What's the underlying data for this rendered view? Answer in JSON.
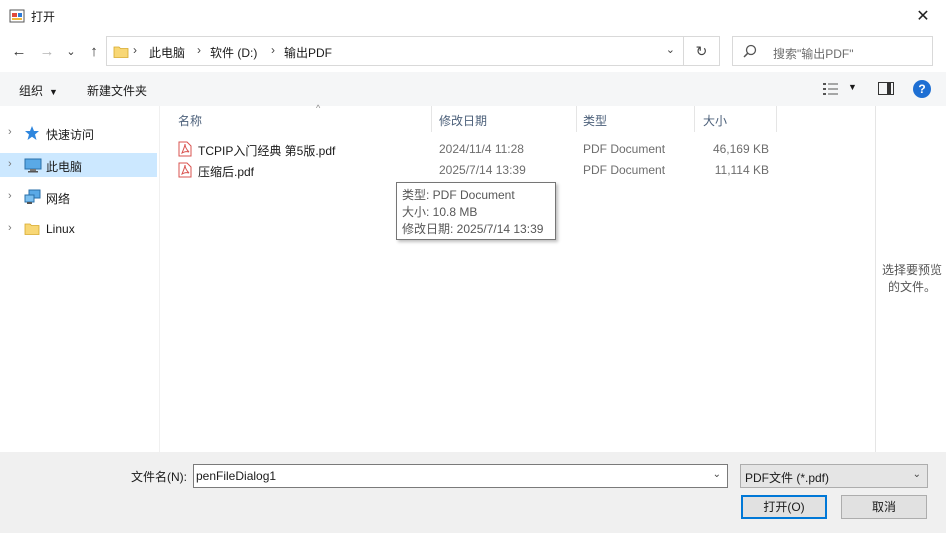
{
  "window": {
    "title": "打开",
    "close_glyph": "✕"
  },
  "nav": {
    "back_glyph": "←",
    "forward_glyph": "→",
    "recent_glyph": "⌄",
    "up_glyph": "↑",
    "refresh_glyph": "↻"
  },
  "address": {
    "crumbs": [
      "此电脑",
      "软件 (D:)",
      "输出PDF"
    ],
    "separator": "›",
    "dropdown_glyph": "⌄"
  },
  "search": {
    "placeholder": "搜索\"输出PDF\""
  },
  "toolbar": {
    "organize_label": "组织",
    "new_folder_label": "新建文件夹",
    "caret_glyph": "▼",
    "help_glyph": "?"
  },
  "sidebar": {
    "items": [
      {
        "label": "快速访问",
        "icon": "star-icon"
      },
      {
        "label": "此电脑",
        "icon": "computer-icon",
        "selected": true
      },
      {
        "label": "网络",
        "icon": "network-icon"
      },
      {
        "label": "Linux",
        "icon": "folder-icon"
      }
    ],
    "chevron_glyph": "›"
  },
  "columns": [
    "名称",
    "修改日期",
    "类型",
    "大小"
  ],
  "sort_glyph": "^",
  "files": [
    {
      "name": "TCPIP入门经典  第5版.pdf",
      "modified": "2024/11/4 11:28",
      "type": "PDF Document",
      "size": "46,169 KB"
    },
    {
      "name": "压缩后.pdf",
      "modified": "2025/7/14 13:39",
      "type": "PDF Document",
      "size": "11,114 KB"
    }
  ],
  "tooltip": {
    "type_line": "类型: PDF Document",
    "size_line": "大小: 10.8 MB",
    "date_line": "修改日期: 2025/7/14 13:39"
  },
  "preview": {
    "text": "选择要预览的文件。"
  },
  "footer": {
    "filename_label": "文件名(N):",
    "filename_value": "penFileDialog1",
    "filter_value": "PDF文件 (*.pdf)",
    "open_label": "打开(O)",
    "cancel_label": "取消",
    "dropdown_glyph": "⌄"
  },
  "colors": {
    "selection": "#cce8ff",
    "accent": "#0078d7",
    "pdf_icon": "#d9534f"
  }
}
